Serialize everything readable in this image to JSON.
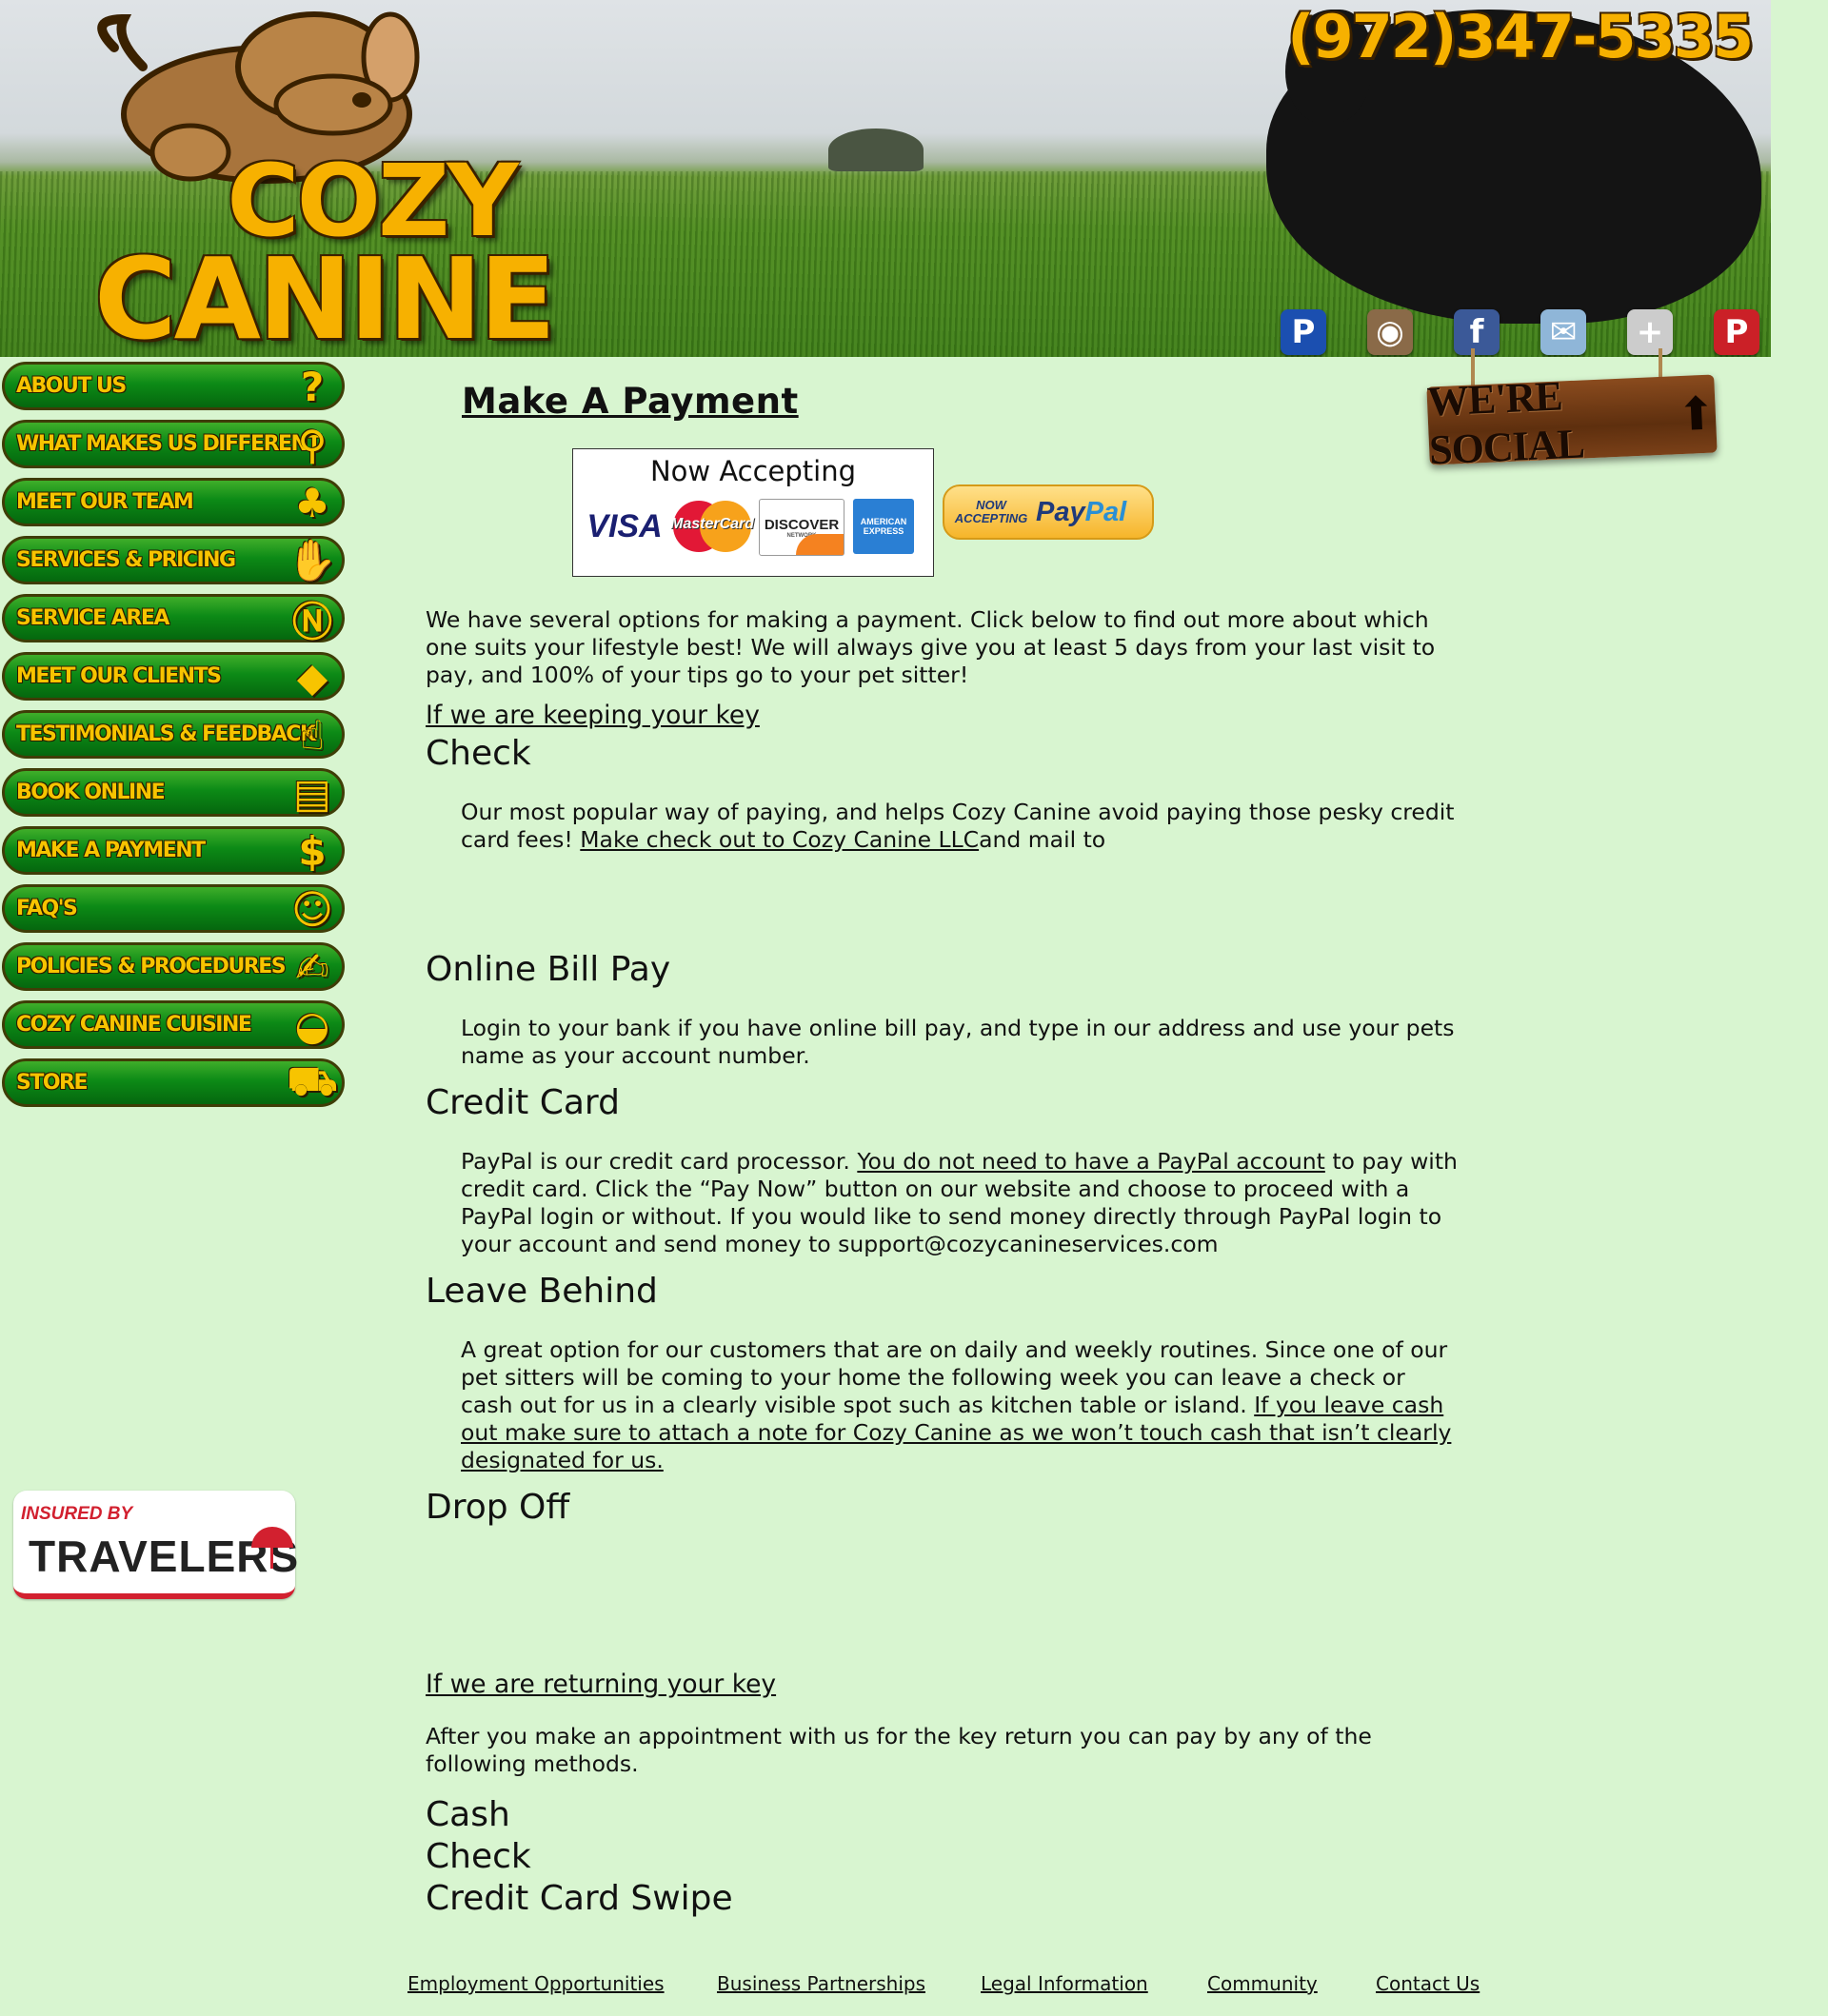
{
  "header": {
    "logo_line1": "COZY",
    "logo_line2": "CANINE",
    "phone": "(972)347-5335",
    "social_icons": [
      {
        "name": "paypal-icon",
        "glyph": "P",
        "color": "#1b4fb0"
      },
      {
        "name": "instagram-icon",
        "glyph": "◉",
        "color": "#8a6a48"
      },
      {
        "name": "facebook-icon",
        "glyph": "f",
        "color": "#3b5998"
      },
      {
        "name": "email-icon",
        "glyph": "✉",
        "color": "#8fb6d8"
      },
      {
        "name": "google-plus-icon",
        "glyph": "+",
        "color": "#cccccc"
      },
      {
        "name": "pinterest-icon",
        "glyph": "P",
        "color": "#cb2027"
      }
    ]
  },
  "social_sign": {
    "text": "WE'RE SOCIAL",
    "arrow": "⬆"
  },
  "sidebar": {
    "items": [
      {
        "label": "ABOUT US",
        "icon": "question-icon",
        "glyph": "?"
      },
      {
        "label": "WHAT MAKES US DIFFERENT",
        "icon": "magnifier-icon",
        "glyph": "⚲"
      },
      {
        "label": "MEET OUR TEAM",
        "icon": "team-icon",
        "glyph": "♣"
      },
      {
        "label": "SERVICES & PRICING",
        "icon": "money-hand-icon",
        "glyph": "✋"
      },
      {
        "label": "SERVICE AREA",
        "icon": "compass-icon",
        "glyph": "Ⓝ"
      },
      {
        "label": "MEET OUR CLIENTS",
        "icon": "dog-icon",
        "glyph": "◆"
      },
      {
        "label": "TESTIMONIALS & FEEDBACK",
        "icon": "thumbs-up-icon",
        "glyph": "☝"
      },
      {
        "label": "BOOK ONLINE",
        "icon": "book-icon",
        "glyph": "▤"
      },
      {
        "label": "MAKE A PAYMENT",
        "icon": "cash-icon",
        "glyph": "$"
      },
      {
        "label": "FAQ'S",
        "icon": "person-icon",
        "glyph": "☺"
      },
      {
        "label": "POLICIES & PROCEDURES",
        "icon": "pen-hand-icon",
        "glyph": "✍"
      },
      {
        "label": "COZY CANINE CUISINE",
        "icon": "food-bowl-icon",
        "glyph": "◒"
      },
      {
        "label": "STORE",
        "icon": "cart-icon",
        "glyph": "⛟"
      }
    ],
    "travelers": {
      "small": "INSURED BY",
      "big": "TRAVELERS"
    }
  },
  "main": {
    "title": "Make A Payment",
    "accepting_heading": "Now Accepting",
    "cards": {
      "visa": "VISA",
      "mastercard": "MasterCard",
      "discover": "DISCOVER",
      "discover_sub": "NETWORK",
      "amex_1": "AMERICAN",
      "amex_2": "EXPRESS"
    },
    "paypal_badge": {
      "now": "NOW",
      "accepting": "ACCEPTING",
      "pay": "Pay",
      "pal": "Pal"
    },
    "intro": "We have several options for making a payment. Click below to find out more about which one suits your lifestyle best! We will always give you at least 5 days from your last visit to pay, and 100% of your tips go to your pet sitter!",
    "keeping_link": "If we are keeping your key",
    "check_heading": "Check",
    "check_text_1": "Our most popular way of paying, and helps Cozy Canine avoid paying those pesky credit card fees! ",
    "check_link": "Make check out to Cozy Canine LLC",
    "check_text_2": "and mail to",
    "online_heading": "Online Bill Pay",
    "online_text": "Login to your bank if you have online bill pay, and type in our address and use your pets name as your account number.",
    "credit_heading": "Credit Card",
    "credit_text_1": "PayPal is our credit card processor. ",
    "credit_link": "You do not need to have a PayPal account",
    "credit_text_2": " to pay with credit card. Click the “Pay Now” button on our website and choose to proceed with a PayPal login or without. If you would like to send money directly through PayPal login to your account and send money to support@cozycanineservices.com",
    "leave_heading": "Leave Behind",
    "leave_text_1": "A great option for our customers that are on daily and weekly routines. Since one of our pet sitters will be coming to your home the following week you can leave a check or cash out for us in a clearly visible spot such as kitchen table or island. ",
    "leave_link": "If you leave cash out make sure to attach a note for Cozy Canine as we won’t touch cash that isn’t clearly designated for us.",
    "drop_heading": "Drop Off",
    "returning_link": "If we are returning your key",
    "returning_text": "After you make an appointment with us for the key return you can pay by any of the following methods.",
    "methods": [
      "Cash",
      "Check",
      "Credit Card Swipe"
    ]
  },
  "footer": {
    "links": [
      "Employment Opportunities",
      "Business Partnerships",
      "Legal Information",
      "Community",
      "Contact Us"
    ]
  }
}
